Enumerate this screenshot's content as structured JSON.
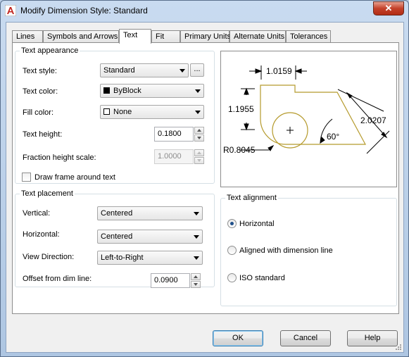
{
  "window": {
    "title": "Modify Dimension Style: Standard",
    "close_glyph": "✕"
  },
  "tabs": [
    {
      "label": "Lines"
    },
    {
      "label": "Symbols and Arrows"
    },
    {
      "label": "Text"
    },
    {
      "label": "Fit"
    },
    {
      "label": "Primary Units"
    },
    {
      "label": "Alternate Units"
    },
    {
      "label": "Tolerances"
    }
  ],
  "active_tab": "Text",
  "text_appearance": {
    "title": "Text appearance",
    "text_style_label": "Text style:",
    "text_style_value": "Standard",
    "text_style_more": "...",
    "text_color_label": "Text color:",
    "text_color_value": "ByBlock",
    "text_color_swatch": "#000000",
    "fill_color_label": "Fill color:",
    "fill_color_value": "None",
    "fill_color_swatch": "#ffffff",
    "text_height_label": "Text height:",
    "text_height_value": "0.1800",
    "fraction_label": "Fraction height scale:",
    "fraction_value": "1.0000",
    "draw_frame_label": "Draw frame around text",
    "draw_frame_checked": false
  },
  "text_placement": {
    "title": "Text placement",
    "vertical_label": "Vertical:",
    "vertical_value": "Centered",
    "horizontal_label": "Horizontal:",
    "horizontal_value": "Centered",
    "view_direction_label": "View Direction:",
    "view_direction_value": "Left-to-Right",
    "offset_label": "Offset from dim line:",
    "offset_value": "0.0900"
  },
  "preview": {
    "dim_top": "1.0159",
    "dim_left": "1.1955",
    "dim_right": "2.0207",
    "dim_angle": "60°",
    "dim_radius": "R0.8045",
    "shape_color": "#b59a2c"
  },
  "text_alignment": {
    "title": "Text alignment",
    "options": [
      {
        "label": "Horizontal",
        "selected": true
      },
      {
        "label": "Aligned with dimension line",
        "selected": false
      },
      {
        "label": "ISO standard",
        "selected": false
      }
    ]
  },
  "buttons": {
    "ok": "OK",
    "cancel": "Cancel",
    "help": "Help"
  }
}
